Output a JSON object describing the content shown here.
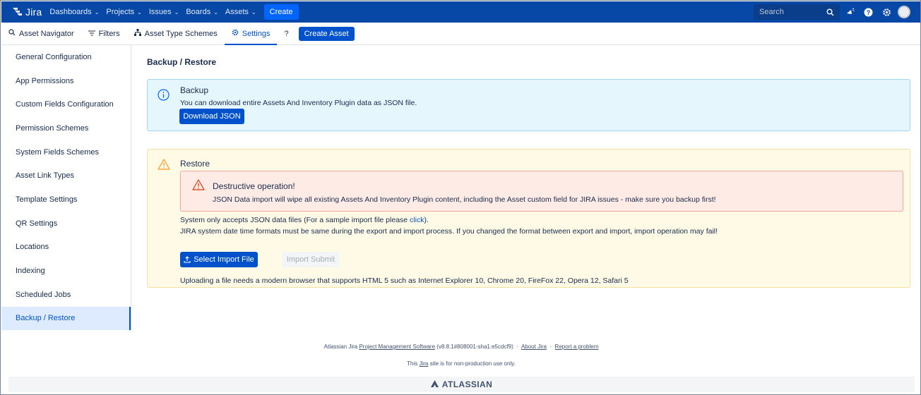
{
  "topnav": {
    "logo_text": "Jira",
    "items": [
      "Dashboards",
      "Projects",
      "Issues",
      "Boards",
      "Assets"
    ],
    "create_label": "Create",
    "search_placeholder": "Search"
  },
  "subnav": {
    "asset_navigator": "Asset Navigator",
    "filters": "Filters",
    "asset_type_schemes": "Asset Type Schemes",
    "settings": "Settings",
    "help": "?",
    "create_asset": "Create Asset"
  },
  "sidebar": {
    "items": [
      "General Configuration",
      "App Permissions",
      "Custom Fields Configuration",
      "Permission Schemes",
      "System Fields Schemes",
      "Asset Link Types",
      "Template Settings",
      "QR Settings",
      "Locations",
      "Indexing",
      "Scheduled Jobs",
      "Backup / Restore"
    ],
    "selected_index": 11
  },
  "main": {
    "title": "Backup / Restore",
    "backup": {
      "title": "Backup",
      "text": "You can download entire Assets And Inventory Plugin data as JSON file.",
      "button": "Download JSON"
    },
    "restore": {
      "title": "Restore",
      "danger_title": "Destructive operation!",
      "danger_text": "JSON Data import will wipe all existing Assets And Inventory Plugin content, including the Asset custom field for JIRA issues - make sure you backup first!",
      "accepts_prefix": "System only accepts JSON data files (For a sample import file please ",
      "accepts_link": "click",
      "accepts_suffix": ").",
      "date_note": "JIRA system date time formats must be same during the export and import process. If you changed the format between export and import, import operation may fail!",
      "select_button": "Select Import File",
      "submit_button": "Import Submit",
      "browser_note": "Uploading a file needs a modern browser that supports HTML 5 such as Internet Explorer 10, Chrome 20, FireFox 22, Opera 12, Safari 5"
    }
  },
  "footer": {
    "prefix": "Atlassian Jira ",
    "pms_link": "Project Management Software",
    "version": " (v8.8.1#808001-sha1:e5cdcf9)",
    "sep": "·",
    "about": "About Jira",
    "report": "Report a problem",
    "line2_prefix": "This ",
    "line2_link": "Jira",
    "line2_suffix": " site is for non-production use only.",
    "brand": "ATLASSIAN"
  },
  "colors": {
    "nav_bg": "#0747a6",
    "primary": "#0052cc",
    "info_bg": "#e6f6fd",
    "warning_bg": "#fffae6",
    "error_bg": "#ffebe6"
  }
}
